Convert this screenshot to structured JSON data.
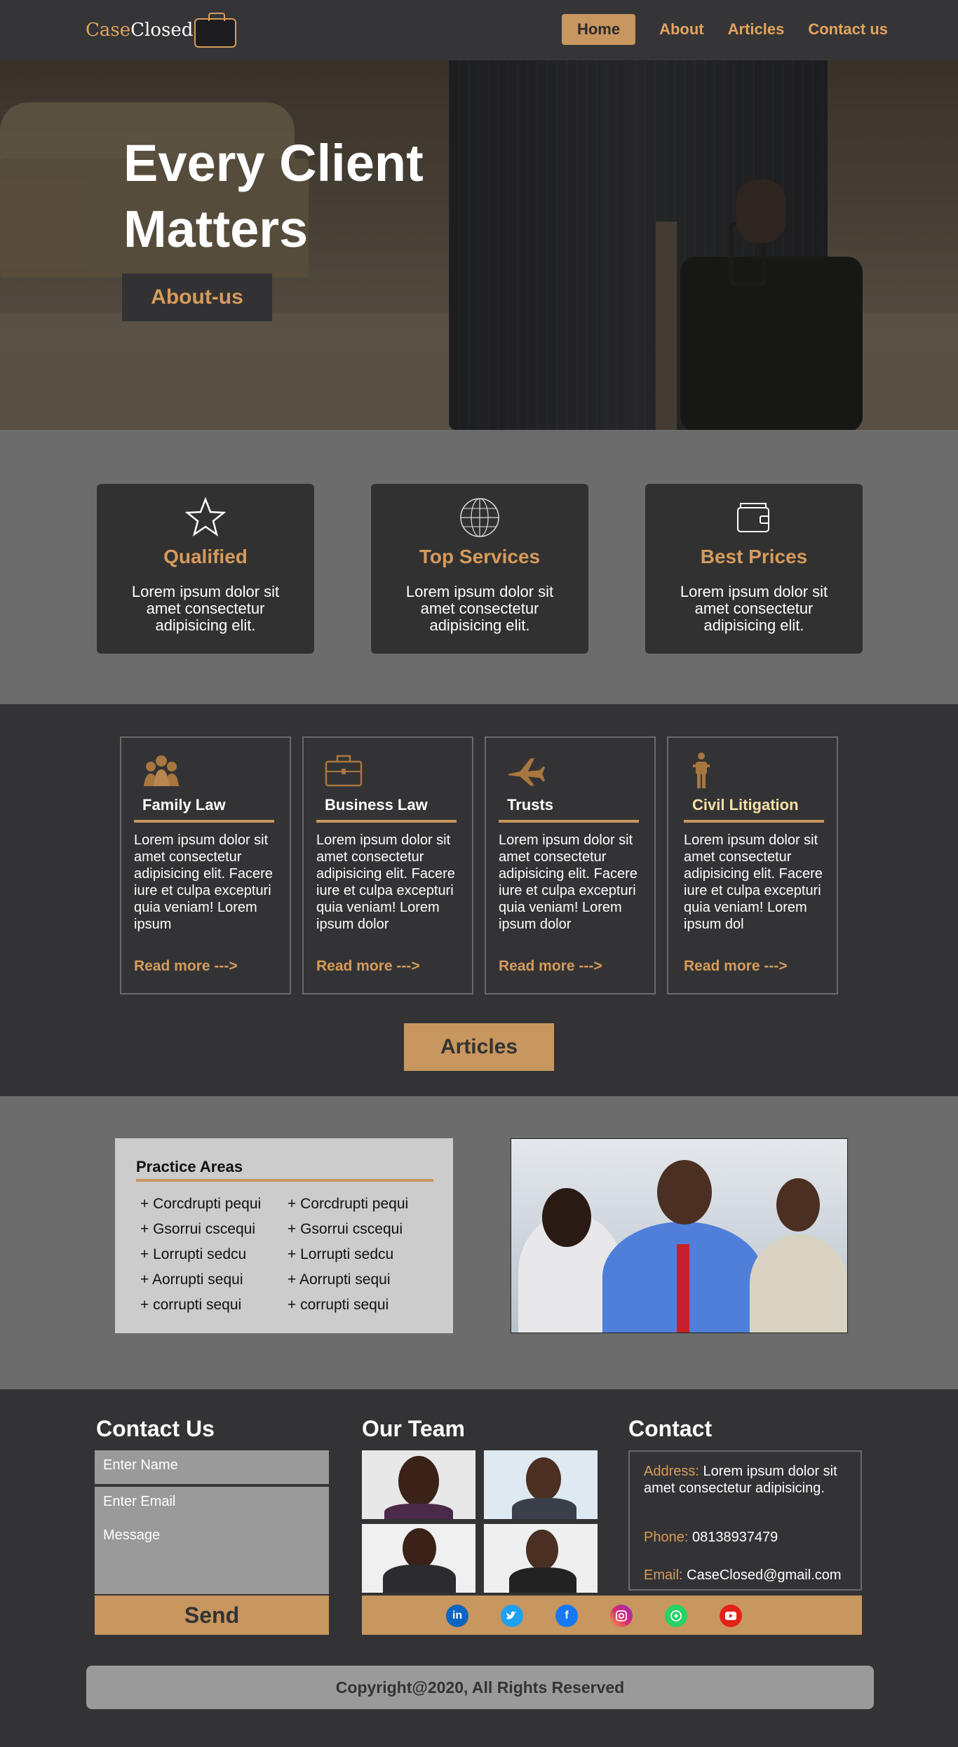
{
  "nav": {
    "logo_part1": "Case",
    "logo_part2": "Closed",
    "links": [
      "Home",
      "About",
      "Articles",
      "Contact us"
    ]
  },
  "hero": {
    "title_line1": "Every Client",
    "title_line2": "Matters",
    "button": "About-us"
  },
  "features": [
    {
      "icon": "star-icon",
      "title": "Qualified",
      "text": "Lorem ipsum dolor sit amet consectetur adipisicing elit."
    },
    {
      "icon": "globe-icon",
      "title": "Top Services",
      "text": "Lorem ipsum dolor sit amet consectetur adipisicing elit."
    },
    {
      "icon": "wallet-icon",
      "title": "Best Prices",
      "text": "Lorem ipsum dolor sit amet consectetur adipisicing elit."
    }
  ],
  "practice": {
    "cards": [
      {
        "icon": "family-icon",
        "title": "Family Law",
        "text": "Lorem ipsum dolor sit amet consectetur adipisicing elit. Facere iure et culpa excepturi quia veniam! Lorem ipsum",
        "more": "Read more --->"
      },
      {
        "icon": "briefcase-icon",
        "title": "Business Law",
        "text": "Lorem ipsum dolor sit amet consectetur adipisicing elit. Facere iure et culpa excepturi quia veniam! Lorem ipsum dolor",
        "more": "Read more --->"
      },
      {
        "icon": "airplane-icon",
        "title": "Trusts",
        "text": "Lorem ipsum dolor sit amet consectetur adipisicing elit. Facere iure et culpa excepturi quia veniam! Lorem ipsum dolor",
        "more": "Read more --->"
      },
      {
        "icon": "person-icon",
        "title": "Civil Litigation",
        "text": "Lorem ipsum dolor sit amet consectetur adipisicing elit. Facere iure et culpa excepturi quia veniam! Lorem ipsum dol",
        "more": "Read more --->"
      }
    ],
    "articles_button": "Articles"
  },
  "areas": {
    "title": "Practice Areas",
    "col1": [
      "+ Corcdrupti pequi",
      "+ Gsorrui cscequi",
      "+ Lorrupti sedcu",
      "+ Aorrupti sequi",
      "+ corrupti sequi"
    ],
    "col2": [
      "+ Corcdrupti pequi",
      "+ Gsorrui cscequi",
      "+ Lorrupti sedcu",
      "+ Aorrupti sequi",
      "+ corrupti sequi"
    ]
  },
  "footer": {
    "contact_us_title": "Contact Us",
    "name_placeholder": "Enter Name",
    "email_placeholder": "Enter Email",
    "message_placeholder": "Message",
    "send": "Send",
    "team_title": "Our Team",
    "social": [
      "linkedin-icon",
      "twitter-icon",
      "facebook-icon",
      "instagram-icon",
      "whatsapp-icon",
      "youtube-icon"
    ],
    "contact_title": "Contact",
    "address_label": "Address:",
    "address_value": "Lorem ipsum dolor sit amet consectetur adipisicing.",
    "phone_label": "Phone:",
    "phone_value": "08138937479",
    "email_label": "Email:",
    "email_value": "CaseClosed@gmail.com",
    "copyright": "Copyright@2020, All Rights Reserved"
  },
  "colors": {
    "accent": "#c8965f",
    "dark": "#333335",
    "mid_grey": "#6c6c6c"
  }
}
